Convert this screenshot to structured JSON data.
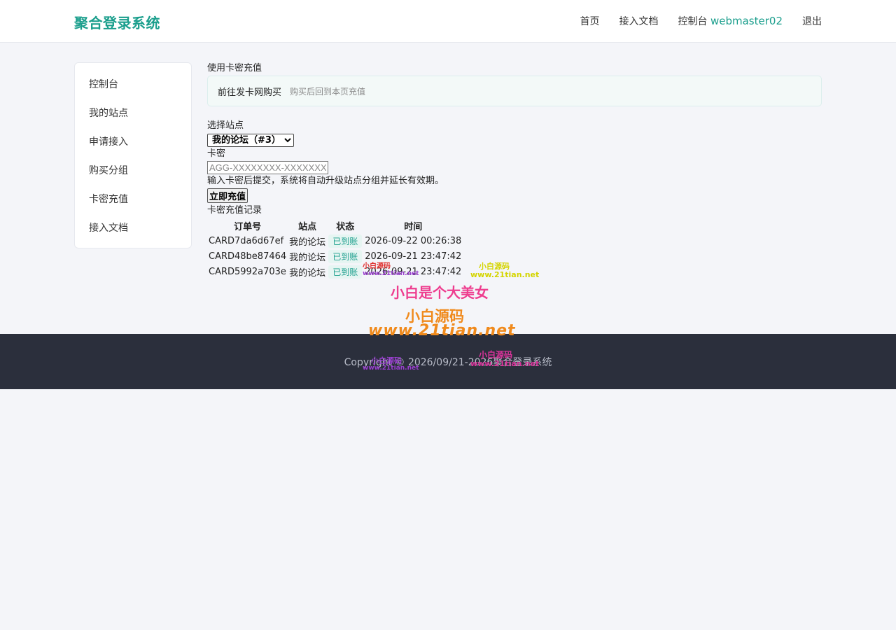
{
  "header": {
    "brand": "聚合登录系统",
    "nav": {
      "home": "首页",
      "docs": "接入文档",
      "console": "控制台",
      "username": "webmaster02",
      "logout": "退出"
    }
  },
  "sidebar": {
    "items": [
      {
        "label": "控制台"
      },
      {
        "label": "我的站点"
      },
      {
        "label": "申请接入"
      },
      {
        "label": "购买分组"
      },
      {
        "label": "卡密充值"
      },
      {
        "label": "接入文档"
      }
    ]
  },
  "recharge": {
    "title": "使用卡密充值",
    "buy_link": "前往发卡网购买",
    "buy_hint": "购买后回到本页充值"
  },
  "form": {
    "site_label": "选择站点",
    "site_selected": "我的论坛（#3）",
    "card_label": "卡密",
    "card_placeholder": "AGG-XXXXXXXX-XXXXXXXX",
    "help": "输入卡密后提交，系统将自动升级站点分组并延长有效期。",
    "submit": "立即充值"
  },
  "records": {
    "title": "卡密充值记录",
    "columns": [
      "订单号",
      "站点",
      "状态",
      "时间"
    ],
    "rows": [
      {
        "order": "CARD7da6d67ef",
        "site": "我的论坛",
        "status": "已到账",
        "time": "2026-09-22 00:26:38"
      },
      {
        "order": "CARD48be87464",
        "site": "我的论坛",
        "status": "已到账",
        "time": "2026-09-21 23:47:42"
      },
      {
        "order": "CARD5992a703e",
        "site": "我的论坛",
        "status": "已到账",
        "time": "2026-09-21 23:47:42"
      }
    ]
  },
  "footer": {
    "copyright": "Copyright © 2026/09/21-2026聚合登录系统"
  },
  "watermarks": {
    "line1": "小白是个大美女",
    "line2": "小白源码",
    "line3": "www.21tian.net",
    "small_cn": "小白源码",
    "small_url": "www.21tian.net"
  },
  "colors": {
    "accent": "#1a9e8c",
    "footer_bg": "#2b2f3c",
    "page_bg": "#f4f5f9"
  }
}
